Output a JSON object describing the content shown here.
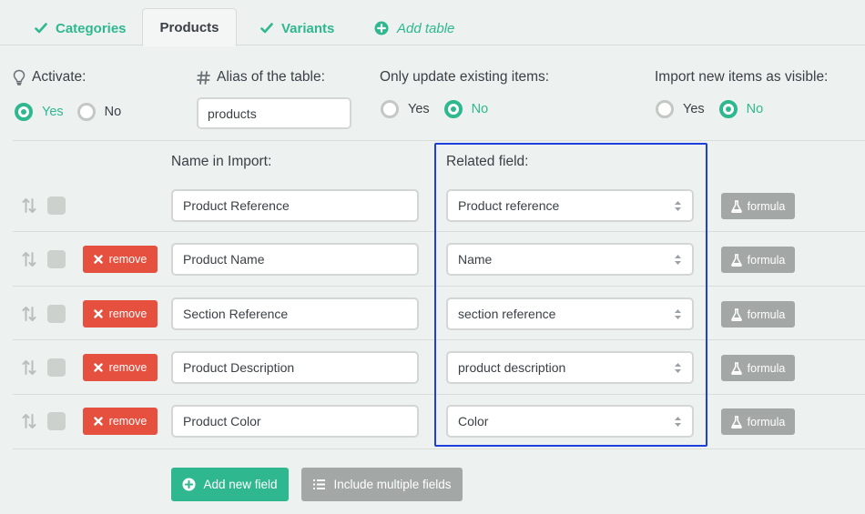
{
  "tabs": [
    {
      "label": "Categories",
      "icon": "check-icon",
      "active": false
    },
    {
      "label": "Products",
      "active": true
    },
    {
      "label": "Variants",
      "icon": "check-icon",
      "active": false
    },
    {
      "label": "Add table",
      "icon": "plus-circle-icon",
      "active": false
    }
  ],
  "options": {
    "activate": {
      "label": "Activate:",
      "icon": "lightbulb-icon",
      "yes": "Yes",
      "no": "No",
      "selected": "Yes"
    },
    "alias": {
      "label": "Alias of the table:",
      "icon": "hash-icon",
      "value": "products"
    },
    "only_update": {
      "label": "Only update existing items:",
      "yes": "Yes",
      "no": "No",
      "selected": "No"
    },
    "import_visible": {
      "label": "Import new items as visible:",
      "yes": "Yes",
      "no": "No",
      "selected": "No"
    }
  },
  "columns": {
    "name_in_import": "Name in Import:",
    "related_field": "Related field:"
  },
  "rows": [
    {
      "name": "Product Reference",
      "related": "Product reference",
      "removable": false
    },
    {
      "name": "Product Name",
      "related": "Name",
      "removable": true
    },
    {
      "name": "Section Reference",
      "related": "section reference",
      "removable": true
    },
    {
      "name": "Product Description",
      "related": "product description",
      "removable": true
    },
    {
      "name": "Product Color",
      "related": "Color",
      "removable": true
    }
  ],
  "labels": {
    "remove": "remove",
    "formula": "formula",
    "add_new_field": "Add new field",
    "include_multiple": "Include multiple fields"
  },
  "colors": {
    "accent": "#2fb890",
    "danger": "#e6503f",
    "muted_button": "#a3a8a6",
    "highlight": "#1d3fdc",
    "background": "#edf1ef"
  }
}
